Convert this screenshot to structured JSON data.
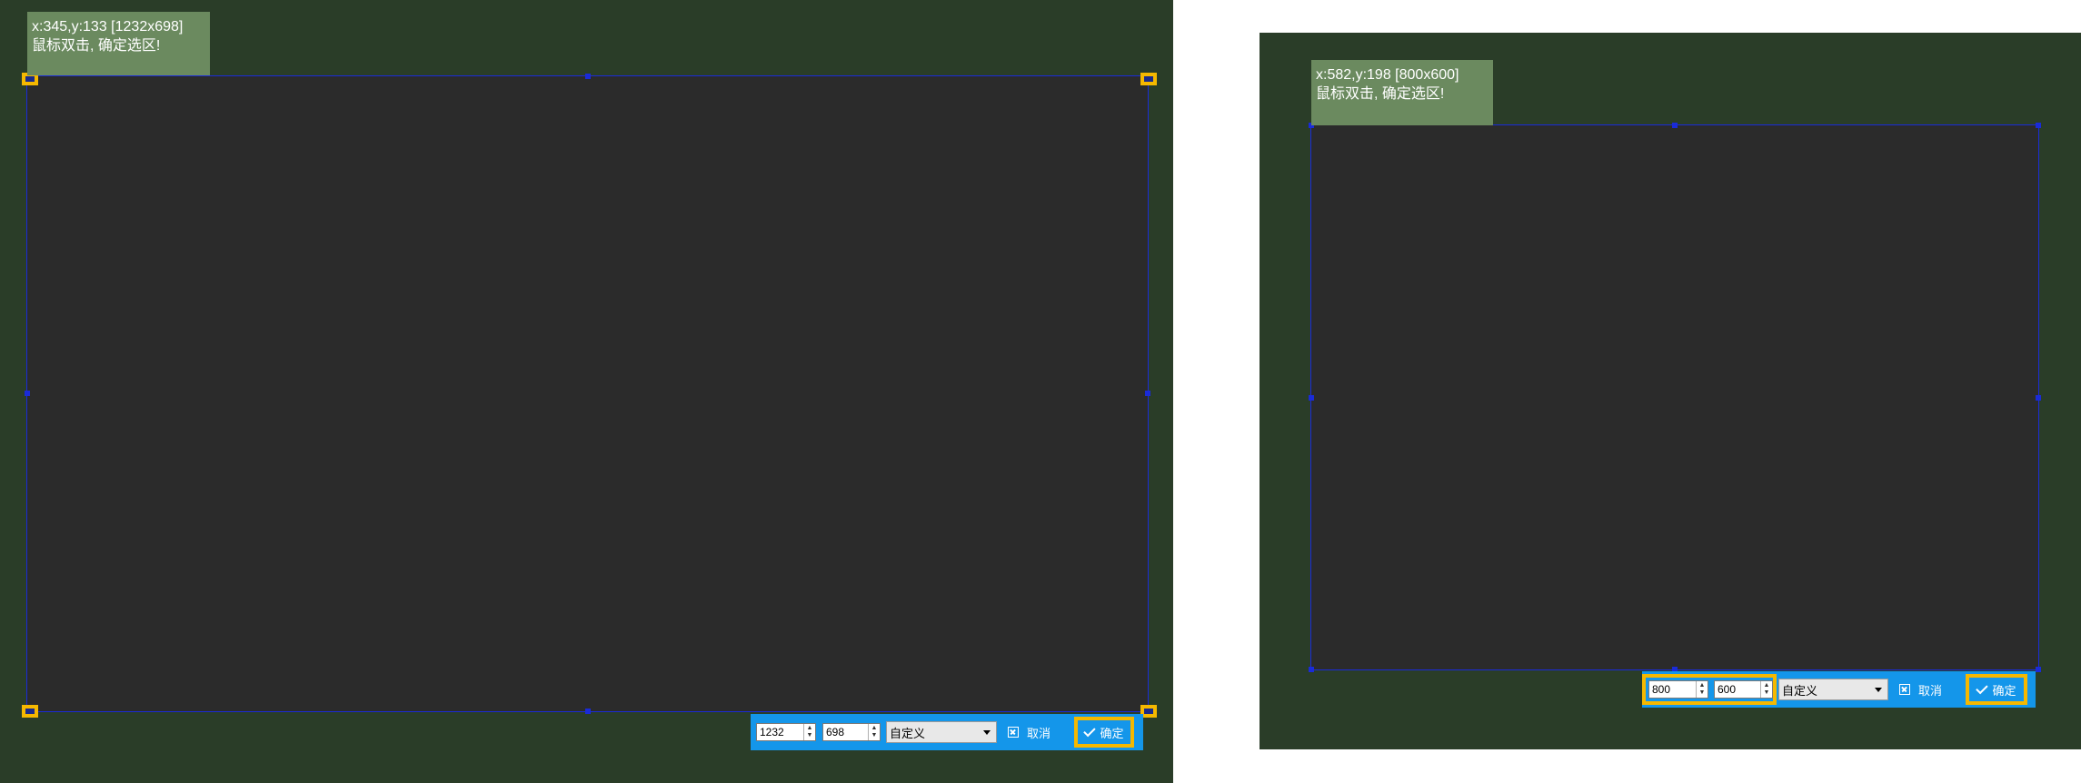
{
  "left": {
    "info_coords": "x:345,y:133 [1232x698]",
    "info_hint": "鼠标双击, 确定选区!",
    "toolbar": {
      "width_value": "1232",
      "height_value": "698",
      "preset": "自定义",
      "cancel_label": "取消",
      "ok_label": "确定"
    }
  },
  "right": {
    "info_coords": "x:582,y:198 [800x600]",
    "info_hint": "鼠标双击, 确定选区!",
    "toolbar": {
      "width_value": "800",
      "height_value": "600",
      "preset": "自定义",
      "cancel_label": "取消",
      "ok_label": "确定"
    }
  },
  "colors": {
    "background": "#2a3d28",
    "selection": "#2b2b2b",
    "selection_border": "#1a2bd8",
    "toolbar": "#1496ea",
    "highlight": "#f5b800",
    "info_box": "#6b8a5f"
  },
  "icons": [
    "cancel-icon",
    "check-icon",
    "spin-arrows-icon",
    "dropdown-caret-icon"
  ]
}
